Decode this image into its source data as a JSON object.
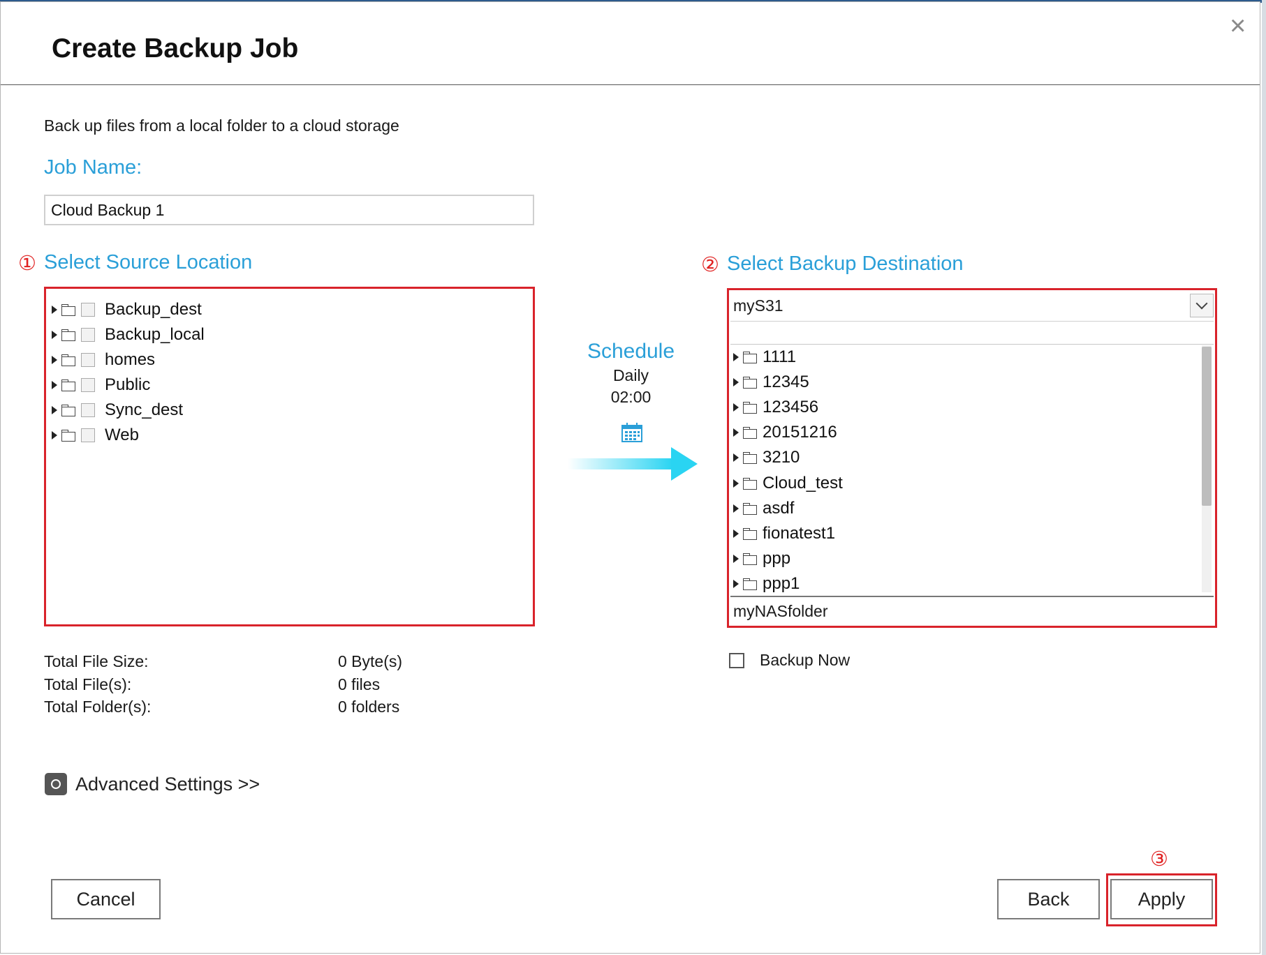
{
  "dialog": {
    "title": "Create Backup Job",
    "close_glyph": "×",
    "description": "Back up files from a local folder to a cloud storage"
  },
  "job": {
    "label": "Job Name:",
    "value": "Cloud Backup 1"
  },
  "source": {
    "marker": "①",
    "label": "Select Source Location",
    "folders": [
      "Backup_dest",
      "Backup_local",
      "homes",
      "Public",
      "Sync_dest",
      "Web"
    ]
  },
  "schedule": {
    "title": "Schedule",
    "frequency": "Daily",
    "time": "02:00",
    "icon": "calendar-icon"
  },
  "destination": {
    "marker": "②",
    "label": "Select Backup Destination",
    "selected": "myS31",
    "folders": [
      "1111",
      "12345",
      "123456",
      "20151216",
      "3210",
      "Cloud_test",
      "asdf",
      "fionatest1",
      "ppp",
      "ppp1"
    ],
    "path": "myNASfolder"
  },
  "stats": {
    "size_label": "Total File Size:",
    "size_value": "0 Byte(s)",
    "files_label": "Total File(s):",
    "files_value": "0 files",
    "folders_label": "Total Folder(s):",
    "folders_value": "0 folders"
  },
  "backup_now": {
    "label": "Backup Now"
  },
  "advanced": {
    "label": "Advanced Settings >>",
    "icon": "gear-icon"
  },
  "buttons": {
    "cancel": "Cancel",
    "back": "Back",
    "apply": "Apply",
    "apply_marker": "③"
  },
  "colors": {
    "accent": "#2a9fd8",
    "highlight": "#d9232b"
  }
}
